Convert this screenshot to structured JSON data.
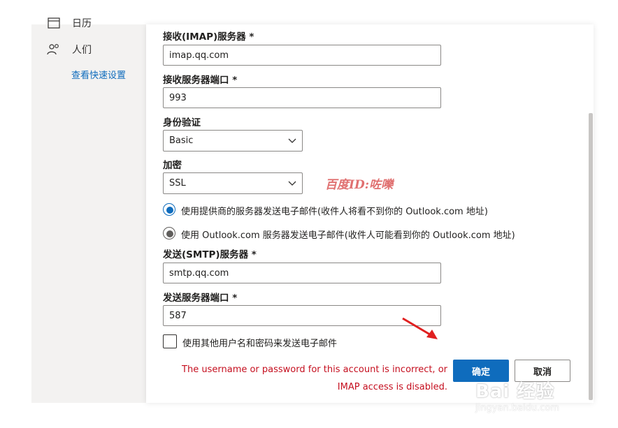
{
  "sidebar": {
    "items": [
      {
        "label": "日历",
        "icon": "calendar-icon"
      },
      {
        "label": "人们",
        "icon": "people-icon"
      }
    ],
    "quick_settings_link": "查看快速设置"
  },
  "form": {
    "imap_server": {
      "label": "接收(IMAP)服务器 *",
      "value": "imap.qq.com"
    },
    "imap_port": {
      "label": "接收服务器端口 *",
      "value": "993"
    },
    "auth": {
      "label": "身份验证",
      "value": "Basic"
    },
    "encryption": {
      "label": "加密",
      "value": "SSL"
    },
    "radio_provider": {
      "label": "使用提供商的服务器发送电子邮件(收件人将看不到你的 Outlook.com 地址)",
      "selected": true
    },
    "radio_outlook": {
      "label": "使用 Outlook.com 服务器发送电子邮件(收件人可能看到你的 Outlook.com 地址)",
      "selected": false
    },
    "smtp_server": {
      "label": "发送(SMTP)服务器 *",
      "value": "smtp.qq.com"
    },
    "smtp_port": {
      "label": "发送服务器端口 *",
      "value": "587"
    },
    "other_credentials": {
      "label": "使用其他用户名和密码来发送电子邮件",
      "checked": false
    }
  },
  "error_message": "The username or password for this account is incorrect, or IMAP access is disabled.",
  "buttons": {
    "ok": "确定",
    "cancel": "取消"
  },
  "overlay_text": "百度ID:咗嚛",
  "watermark": {
    "main": "Bai 经验",
    "sub": "jingyan.baidu.com"
  },
  "colors": {
    "accent": "#0f6cbd",
    "error": "#c50f1f",
    "overlay": "#e07070",
    "arrow": "#e02020"
  }
}
